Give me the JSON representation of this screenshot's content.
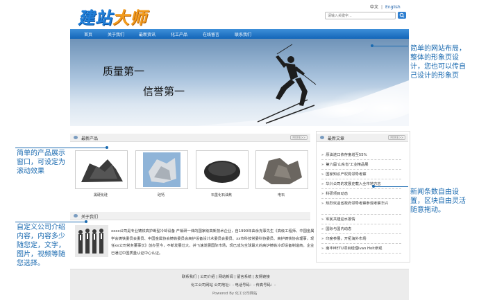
{
  "header": {
    "logo_part1": "建站",
    "logo_part2": "大师",
    "lang_cn": "中文",
    "lang_sep": "|",
    "lang_en": "English",
    "search_placeholder": "请输入关键字..."
  },
  "nav": [
    "首页",
    "关于我们",
    "最新资讯",
    "化工产品",
    "在线留言",
    "联系我们"
  ],
  "banner": {
    "slogan1": "质量第一",
    "slogan2": "信誉第一"
  },
  "products": {
    "title": "最新产品",
    "more": "MORE>>",
    "items": [
      "黑硬化硅",
      "硅钙",
      "石墨化石油焦",
      "电石"
    ]
  },
  "news": {
    "title": "最新文章",
    "more": "MORE>>",
    "items": [
      "原油进口依存度增至55%",
      "第六届'山东省'工业精品展",
      "国家知识产权局领导考察",
      "华兴公司的发展史载入全市地方志",
      "科研项目动态",
      "热烈欢迎省政府领导考察参观考察华兴",
      "军民共建迎水报情",
      "国际与国内动态",
      "印度参展，开拓海外市场",
      "南丰METU项目经理Ivan Holt参观"
    ]
  },
  "about": {
    "title": "关于我们",
    "text": "xxxx公司是专业铸铁高护断型冷却设备 产销研一体的国家级高新技术企业，自1990年由余克事先生《高级工程师、中国金属学会铸铁委员会委员、中国金属协会铸铁委员会高护设备设计术委员会委员、xx市科技常委科协委员、高护铸铁协会理事，现任xx公司常务董事长》创办至今，不断发展壮大，并飞速发展国际市场，现已成为全球最大的高炉铸铁冷却设备制造商。企业已通过中国质量认证中心认证。"
  },
  "footer": {
    "links": [
      "联系我们",
      "|",
      "公司介绍",
      "|",
      "网站新闻",
      "|",
      "留言系统",
      "|",
      "友情链接"
    ],
    "line2": "化工公司网站 公司地址：- 电话号码：- 传真号码：-",
    "line3": "Powered By 化工公司网站"
  },
  "annotations": {
    "layout": "简单的网站布局，整体的形象页设计，您也可以传自己设计的形象页",
    "products": "简单的产品展示窗口，可设定为滚动效果",
    "about": "自定义公司介绍内容，内容多少随您定，文字，图片，视频等随您选择。",
    "news": "新闻条数自由设置，区块自由灵活随意拖动。"
  },
  "colors": {
    "nav": "#1a6ab0",
    "accent": "#f29b1d",
    "annotation": "#1a6ab0"
  }
}
